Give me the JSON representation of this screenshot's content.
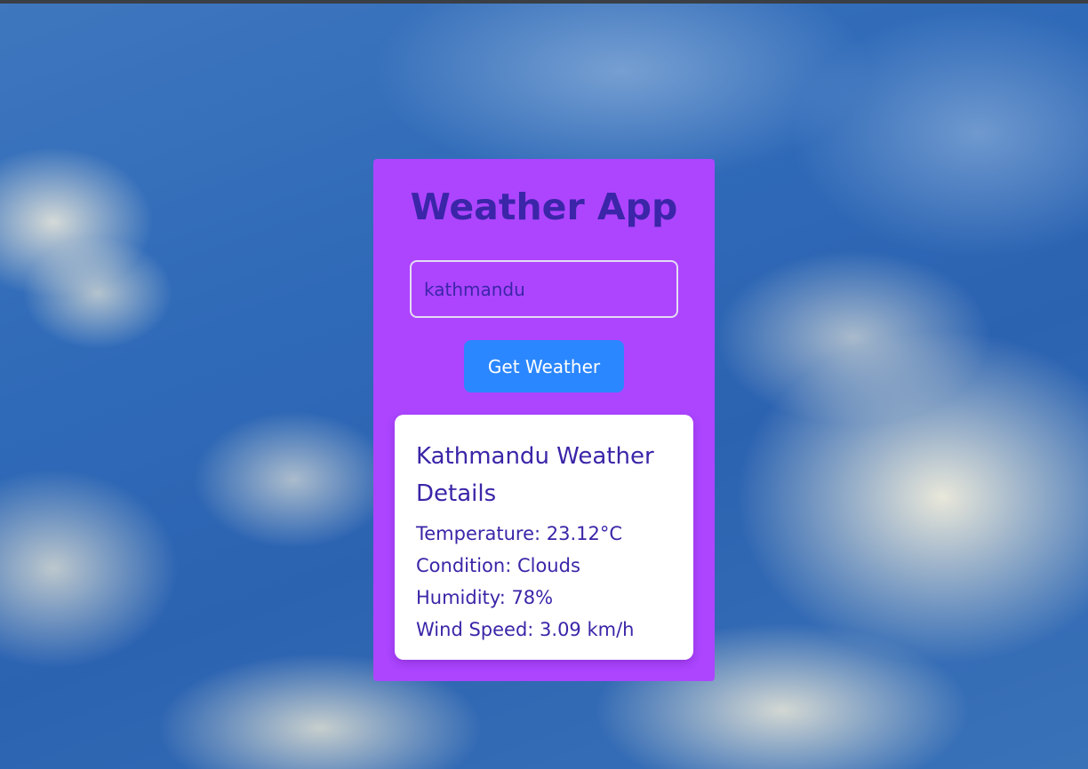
{
  "app": {
    "title": "Weather App"
  },
  "search": {
    "value": "kathmandu",
    "button_label": "Get Weather"
  },
  "result": {
    "heading": "Kathmandu Weather Details",
    "temperature": "Temperature: 23.12°C",
    "condition": "Condition: Clouds",
    "humidity": "Humidity: 78%",
    "wind": "Wind Speed: 3.09 km/h"
  },
  "colors": {
    "card_background": "#ad45ff",
    "title_text": "#3b25a8",
    "button_background": "#2b87ff",
    "result_background": "#ffffff"
  }
}
